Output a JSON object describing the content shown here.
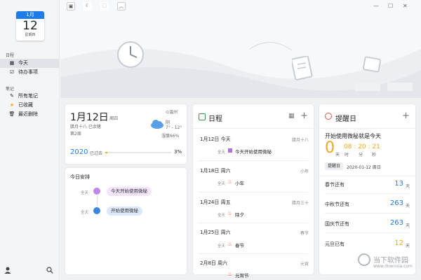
{
  "calendar_icon": {
    "month": "1月",
    "day": "12",
    "weekday": "星期四"
  },
  "sidebar": {
    "section_calendar": "日程",
    "items": [
      {
        "label": "今天",
        "icon": "calendar-icon"
      },
      {
        "label": "待办事项",
        "icon": "checklist-icon"
      }
    ],
    "section_notes": "笔记",
    "note_items": [
      {
        "label": "所有笔记",
        "icon": "pen-icon"
      },
      {
        "label": "已收藏",
        "icon": "star-icon"
      },
      {
        "label": "最近删除",
        "icon": "trash-icon"
      }
    ]
  },
  "colors": {
    "accent": "#1e7ce8",
    "orange": "#f5a623",
    "red": "#e5533d"
  },
  "today_card": {
    "date": "1月12日",
    "weekday": "周四",
    "lunar": "腊月十八 已余猪",
    "week": "第2周",
    "location": "温州",
    "weather": "阴",
    "temp": "7° - 12°",
    "humidity": "湿度66%",
    "year": "2020",
    "year_label": "已过去",
    "year_percent": "3%",
    "year_progress": 0.03
  },
  "today_plan": {
    "title": "今日安排",
    "events": [
      {
        "allday": "全天",
        "label": "今天开始使用微秘"
      },
      {
        "allday": "全天",
        "label": "开始使用微秘"
      }
    ]
  },
  "schedule": {
    "title": "日程",
    "days": [
      {
        "date": "1月12日 今天",
        "lunar": "腊月十八",
        "allday": "全天",
        "event": "今天开始使用微秘"
      },
      {
        "date": "1月18日 周六",
        "lunar": "小年",
        "allday": "全天",
        "event": "小年"
      },
      {
        "date": "1月24日 周五",
        "lunar": "腊月三十",
        "allday": "全天",
        "event": "除夕"
      },
      {
        "date": "1月25日 周六",
        "lunar": "春节",
        "allday": "全天",
        "event": "春节"
      },
      {
        "date": "2月8日 周六",
        "lunar": "元宵",
        "allday": "",
        "event": "元宵节"
      }
    ]
  },
  "reminder": {
    "title": "提醒日",
    "headline": "开始使用微秘就是今天",
    "big_number": "0",
    "big_unit": "天",
    "time": "08 : 20 : 21",
    "time_units": [
      "时",
      "分",
      "秒"
    ],
    "tag": "提醒日",
    "tag_date": "2020-01-12 周日",
    "countdowns": [
      {
        "label": "春节还有",
        "value": "13",
        "unit": "天"
      },
      {
        "label": "中秋节还有",
        "value": "263",
        "unit": "天"
      },
      {
        "label": "国庆节还有",
        "value": "263",
        "unit": "天"
      },
      {
        "label": "元旦已有",
        "value": "12",
        "unit": "天"
      }
    ]
  },
  "watermark": {
    "line1": "当下软件园",
    "line2": "www.downxia.com"
  }
}
